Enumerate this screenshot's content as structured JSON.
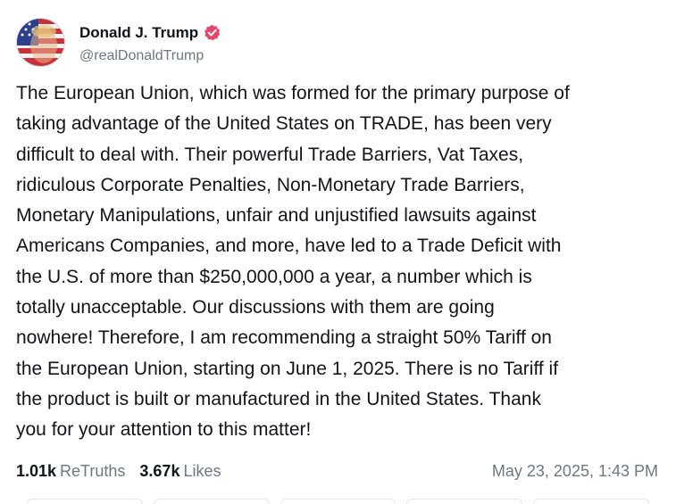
{
  "author": {
    "display_name": "Donald J. Trump",
    "handle": "@realDonaldTrump",
    "verified": true,
    "verified_color": "#e8456b"
  },
  "post": {
    "lines": [
      "The European Union, which was formed for the primary purpose of",
      "taking advantage of the United States on TRADE, has been very",
      "difficult to deal with. Their powerful Trade Barriers, Vat Taxes,",
      "ridiculous Corporate Penalties, Non-Monetary Trade Barriers,",
      "Monetary Manipulations, unfair and unjustified lawsuits against",
      "Americans Companies, and more, have led to a Trade Deficit with",
      "the U.S. of more than $250,000,000 a year, a number which is",
      "totally unacceptable. Our discussions with them are going",
      "nowhere! Therefore, I am recommending a straight 50% Tariff on",
      "the European Union, starting on June 1, 2025. There is no Tariff if",
      "the product is built or manufactured in the United States. Thank",
      "you for your attention to this matter!"
    ]
  },
  "stats": {
    "retruths_count": "1.01k",
    "retruths_label": "ReTruths",
    "likes_count": "3.67k",
    "likes_label": "Likes"
  },
  "timestamp": "May 23, 2025, 1:43 PM"
}
